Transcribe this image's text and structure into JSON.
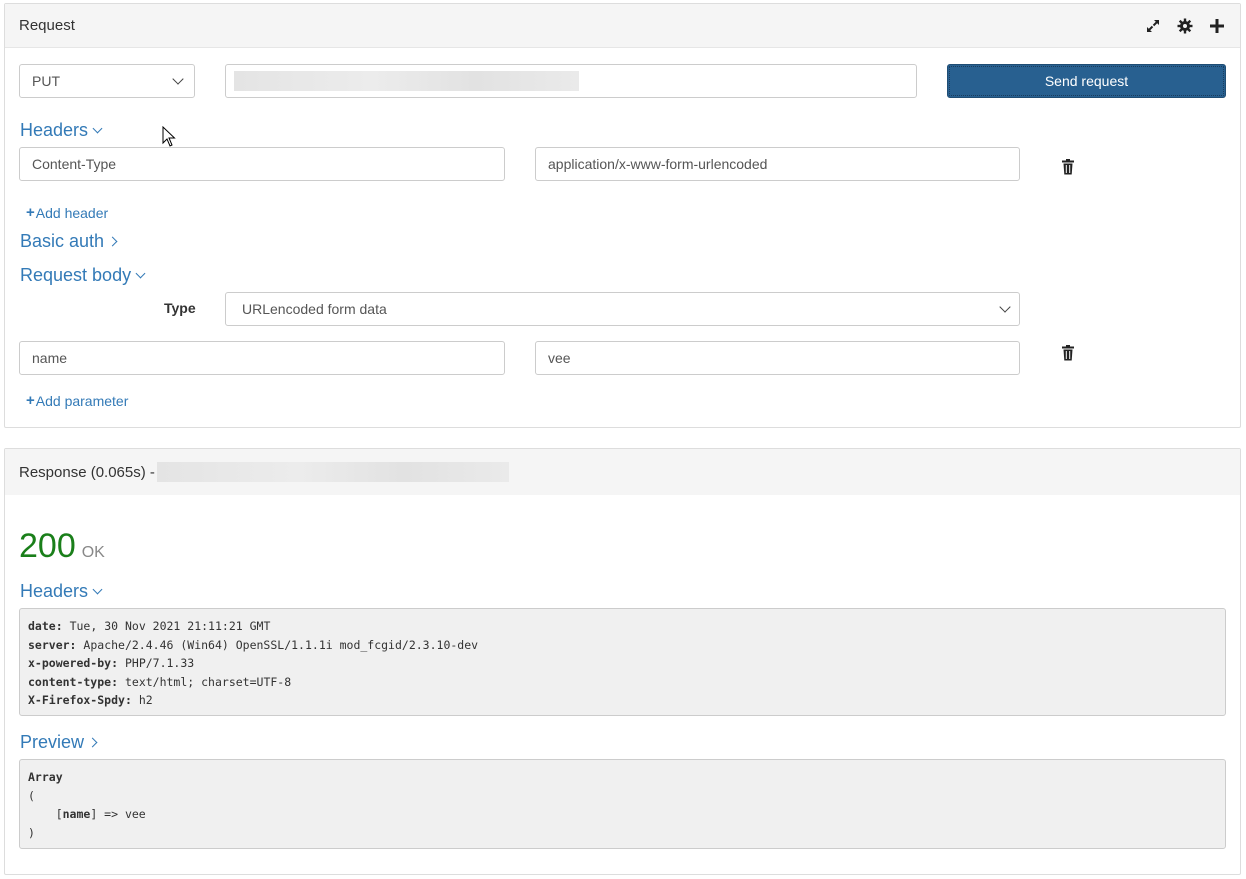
{
  "request_panel": {
    "title": "Request",
    "icons": [
      "expand-icon",
      "gear-icon",
      "plus-icon"
    ],
    "method_select": {
      "value": "PUT"
    },
    "url_input": {
      "value": ""
    },
    "send_button_label": "Send request",
    "headers_section": {
      "label": "Headers",
      "rows": [
        {
          "name": "Content-Type",
          "value": "application/x-www-form-urlencoded"
        }
      ],
      "add_label": "Add header"
    },
    "basic_auth_label": "Basic auth",
    "body_section": {
      "label": "Request body",
      "type_label": "Type",
      "type_value": "URLencoded form data",
      "params": [
        {
          "name": "name",
          "value": "vee"
        }
      ],
      "add_label": "Add parameter"
    }
  },
  "response_panel": {
    "title": "Response (0.065s) -",
    "status_code": "200",
    "status_text": "OK",
    "headers_label": "Headers",
    "headers": [
      {
        "key": "date",
        "value": "Tue, 30 Nov 2021 21:11:21 GMT"
      },
      {
        "key": "server",
        "value": "Apache/2.4.46 (Win64) OpenSSL/1.1.1i mod_fcgid/2.3.10-dev"
      },
      {
        "key": "x-powered-by",
        "value": "PHP/7.1.33"
      },
      {
        "key": "content-type",
        "value": "text/html; charset=UTF-8"
      },
      {
        "key": "X-Firefox-Spdy",
        "value": "h2"
      }
    ],
    "preview_label": "Preview",
    "preview": {
      "line1": "Array",
      "line2": "(",
      "line3_open": "    [",
      "line3_key": "name",
      "line3_rest": "] => vee",
      "line4": ")"
    }
  },
  "colors": {
    "primary": "#286090",
    "link": "#337ab7",
    "status_ok": "#1a7f1a"
  }
}
